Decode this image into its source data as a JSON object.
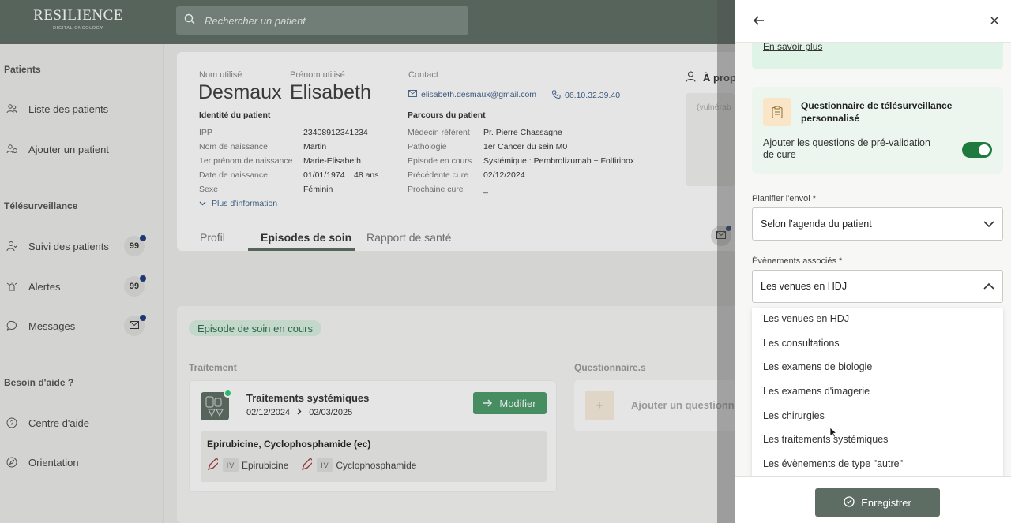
{
  "app": {
    "brand": "RESILIENCE",
    "tagline": "DIGITAL ONCOLOGY"
  },
  "search": {
    "placeholder": "Rechercher un patient"
  },
  "sidebar": {
    "section_patients": "Patients",
    "patients_list": "Liste des patients",
    "add_patient": "Ajouter un patient",
    "section_telesurv": "Télésurveillance",
    "followup": "Suivi des patients",
    "followup_count": "99",
    "alerts": "Alertes",
    "alerts_count": "99",
    "messages": "Messages",
    "section_help": "Besoin d'aide ?",
    "help_center": "Centre d'aide",
    "orientation": "Orientation"
  },
  "patient": {
    "lbl_nom": "Nom utilisé",
    "lbl_prenom": "Prénom utilisé",
    "lbl_contact": "Contact",
    "nom": "Desmaux",
    "prenom": "Elisabeth",
    "email": "elisabeth.desmaux@gmail.com",
    "phone": "06.10.32.39.40",
    "identity_title": "Identité du patient",
    "ipp_k": "IPP",
    "ipp_v": "23408912341234",
    "birthname_k": "Nom de naissance",
    "birthname_v": "Martin",
    "firstname_k": "1er prénom de naissance",
    "firstname_v": "Marie-Elisabeth",
    "dob_k": "Date de naissance",
    "dob_v": "01/01/1974",
    "age": "48 ans",
    "sex_k": "Sexe",
    "sex_v": "Féminin",
    "more_info": "Plus d'information",
    "parcours_title": "Parcours du patient",
    "doctor_k": "Médecin référent",
    "doctor_v": "Pr. Pierre Chassagne",
    "patho_k": "Pathologie",
    "patho_v": "1er Cancer du sein M0",
    "episode_k": "Episode en cours",
    "episode_v": "Systémique : Pembrolizumab + Folfirinox",
    "prev_k": "Précédente cure",
    "prev_v": "02/12/2024",
    "next_k": "Prochaine cure",
    "next_v": "_",
    "apropos": "À prop",
    "vuln": "(vulnérab"
  },
  "tabs": {
    "profil": "Profil",
    "episodes": "Episodes de soin",
    "rapport": "Rapport de santé"
  },
  "episode": {
    "badge": "Episode de soin en cours",
    "col_treat": "Traitement",
    "col_quest": "Questionnaire.s",
    "treat_title": "Traitements systémiques",
    "date_start": "02/12/2024",
    "date_end": "02/03/2025",
    "modify": "Modifier",
    "drug_title": "Epirubicine, Cyclophosphamide (ec)",
    "route": "IV",
    "drug1": "Epirubicine",
    "drug2": "Cyclophosphamide",
    "add_quest": "Ajouter un questionna"
  },
  "panel": {
    "learn_more": "En savoir plus",
    "quest_title": "Questionnaire de télésurveillance personnalisé",
    "quest_option": "Ajouter les questions de pré-validation de cure",
    "plan_label": "Planifier l'envoi *",
    "plan_value": "Selon l'agenda du patient",
    "events_label": "Évènements associés *",
    "events_value": "Les venues en HDJ",
    "options": [
      "Les venues en HDJ",
      "Les consultations",
      "Les examens de biologie",
      "Les examens d'imagerie",
      "Les chirurgies",
      "Les traitements systémiques",
      "Les évènements de type \"autre\""
    ],
    "save": "Enregistrer"
  },
  "colors": {
    "primary": "#5e6d64",
    "accent_green": "#4a9c6a",
    "badge_dot": "#1f3b7a"
  }
}
